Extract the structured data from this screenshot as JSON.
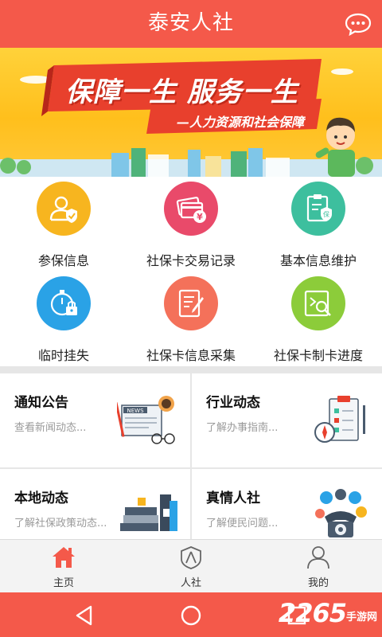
{
  "header": {
    "title": "泰安人社",
    "message_icon": "chat-bubble-icon"
  },
  "banner": {
    "slogan": "保障一生 服务一生",
    "subslogan": "—人力资源和社会保障"
  },
  "grid": {
    "items": [
      {
        "label": "参保信息",
        "icon": "user-shield-icon",
        "color": "#f7b51f"
      },
      {
        "label": "社保卡交易记录",
        "icon": "card-yuan-icon",
        "color": "#e94a6a"
      },
      {
        "label": "基本信息维护",
        "icon": "clipboard-shield-icon",
        "color": "#3dbf9e"
      },
      {
        "label": "临时挂失",
        "icon": "timer-lock-icon",
        "color": "#2aa2e6"
      },
      {
        "label": "社保卡信息采集",
        "icon": "edit-document-icon",
        "color": "#f4715a"
      },
      {
        "label": "社保卡制卡进度",
        "icon": "search-document-icon",
        "color": "#8ccc3a"
      }
    ]
  },
  "cards": [
    {
      "title": "通知公告",
      "subtitle": "查看新闻动态...",
      "icon": "newspaper-illustration"
    },
    {
      "title": "行业动态",
      "subtitle": "了解办事指南...",
      "icon": "clipboard-compass-illustration"
    },
    {
      "title": "本地动态",
      "subtitle": "了解社保政策动态...",
      "icon": "books-illustration"
    },
    {
      "title": "真情人社",
      "subtitle": "了解便民问题...",
      "icon": "telephone-illustration"
    }
  ],
  "tabs": [
    {
      "label": "主页",
      "icon": "home-icon",
      "active": true
    },
    {
      "label": "人社",
      "icon": "person-badge-icon",
      "active": false
    },
    {
      "label": "我的",
      "icon": "user-icon",
      "active": false
    }
  ],
  "watermark": {
    "number": "2265",
    "suffix": "手游网"
  },
  "colors": {
    "primary": "#f4594a",
    "banner": "#ffc21f",
    "tab_active": "#f4594a"
  }
}
